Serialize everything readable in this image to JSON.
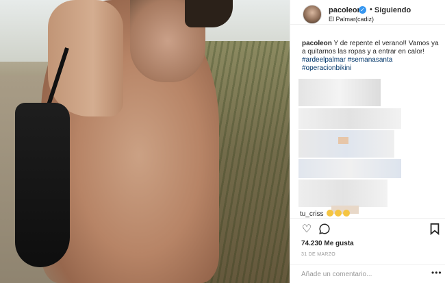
{
  "post": {
    "username": "pacoleon",
    "verified_icon": "verified-badge-icon",
    "separator": "•",
    "follow_status": "Siguiendo",
    "location": "El Palmar(cadiz)"
  },
  "caption": {
    "username": "pacoleon",
    "text": "Y de repente el verano!! Vamos ya a quitarnos las ropas y a entrar en calor!",
    "hashtags": [
      "#ardeelpalmar #semanasanta",
      "#operacionbikini"
    ]
  },
  "comments": {
    "visible_user": "tu_criss"
  },
  "actions": {
    "like_icon": "heart-icon",
    "comment_icon": "comment-icon",
    "save_icon": "bookmark-icon"
  },
  "stats": {
    "likes": "74.230 Me gusta",
    "date": "31 DE MARZO"
  },
  "add_comment": {
    "placeholder": "Añade un comentario...",
    "more": "•••"
  },
  "colors": {
    "verified": "#3897f0",
    "hashtag": "#003569",
    "muted": "#999999"
  }
}
